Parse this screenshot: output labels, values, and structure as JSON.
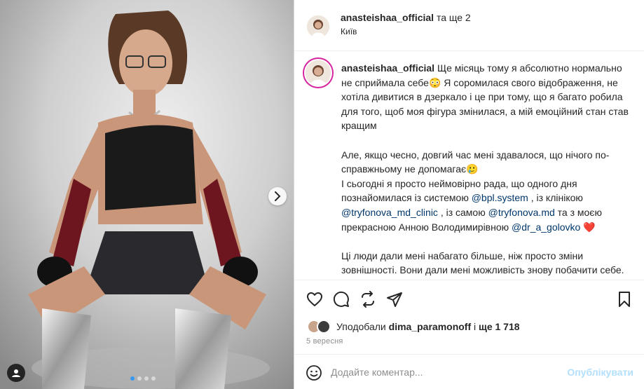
{
  "post": {
    "header": {
      "username": "anasteishaa_official",
      "coauthors": "та ще 2",
      "location": "Київ"
    },
    "caption": {
      "username": "anasteishaa_official",
      "p1": " Ще місяць тому я абсолютно нормально не сприймала себе😳 Я соромилася свого відображення, не хотіла дивитися в дзеркало і це при тому, що я багато робила для того, щоб моя фігура змінилася, а мій емоційний стан став кращим",
      "p2": "Але, якщо чесно, довгий час мені здавалося, що нічого по-справжньому не допомагає🥲",
      "p3a": "І сьогодні я просто неймовірно рада, що одного дня познайомилася із системою ",
      "mention1": "@bpl.system",
      "p3b": " , із клінікою ",
      "mention2": "@tryfonova_md_clinic",
      "p3c": " , із самою ",
      "mention3": "@tryfonova.md",
      "p3d": " та з моєю прекрасною Анною Володимирівною ",
      "mention4": "@dr_a_golovko",
      "heart": " ❤️",
      "p4": "Ці люди дали мені набагато більше, ніж просто зміни зовнішності. Вони дали мені можливість знову побачити себе. Полюбити себе. Прийняти себе. І сьогодні я можу чесно сказати — я люблю себе на мільйон відсотків😊"
    },
    "likes": {
      "prefix": "Уподобали ",
      "user": "dima_paramonoff",
      "middle": " і ",
      "count": "ще 1 718"
    },
    "date": "5 вересня",
    "comment": {
      "placeholder": "Додайте коментар...",
      "publish_label": "Опублікувати"
    },
    "carousel": {
      "total": 4,
      "active_index": 0
    }
  },
  "icons": {
    "actions": [
      "heart-icon",
      "comment-icon",
      "share-icon",
      "send-icon",
      "bookmark-icon"
    ],
    "other": [
      "chevron-right-icon",
      "emoji-icon",
      "tag-user-icon"
    ]
  },
  "colors": {
    "mention": "#00376b",
    "publish_disabled": "#b2dffc",
    "story_ring": "#d6249f",
    "active_dot": "#3897f0"
  }
}
